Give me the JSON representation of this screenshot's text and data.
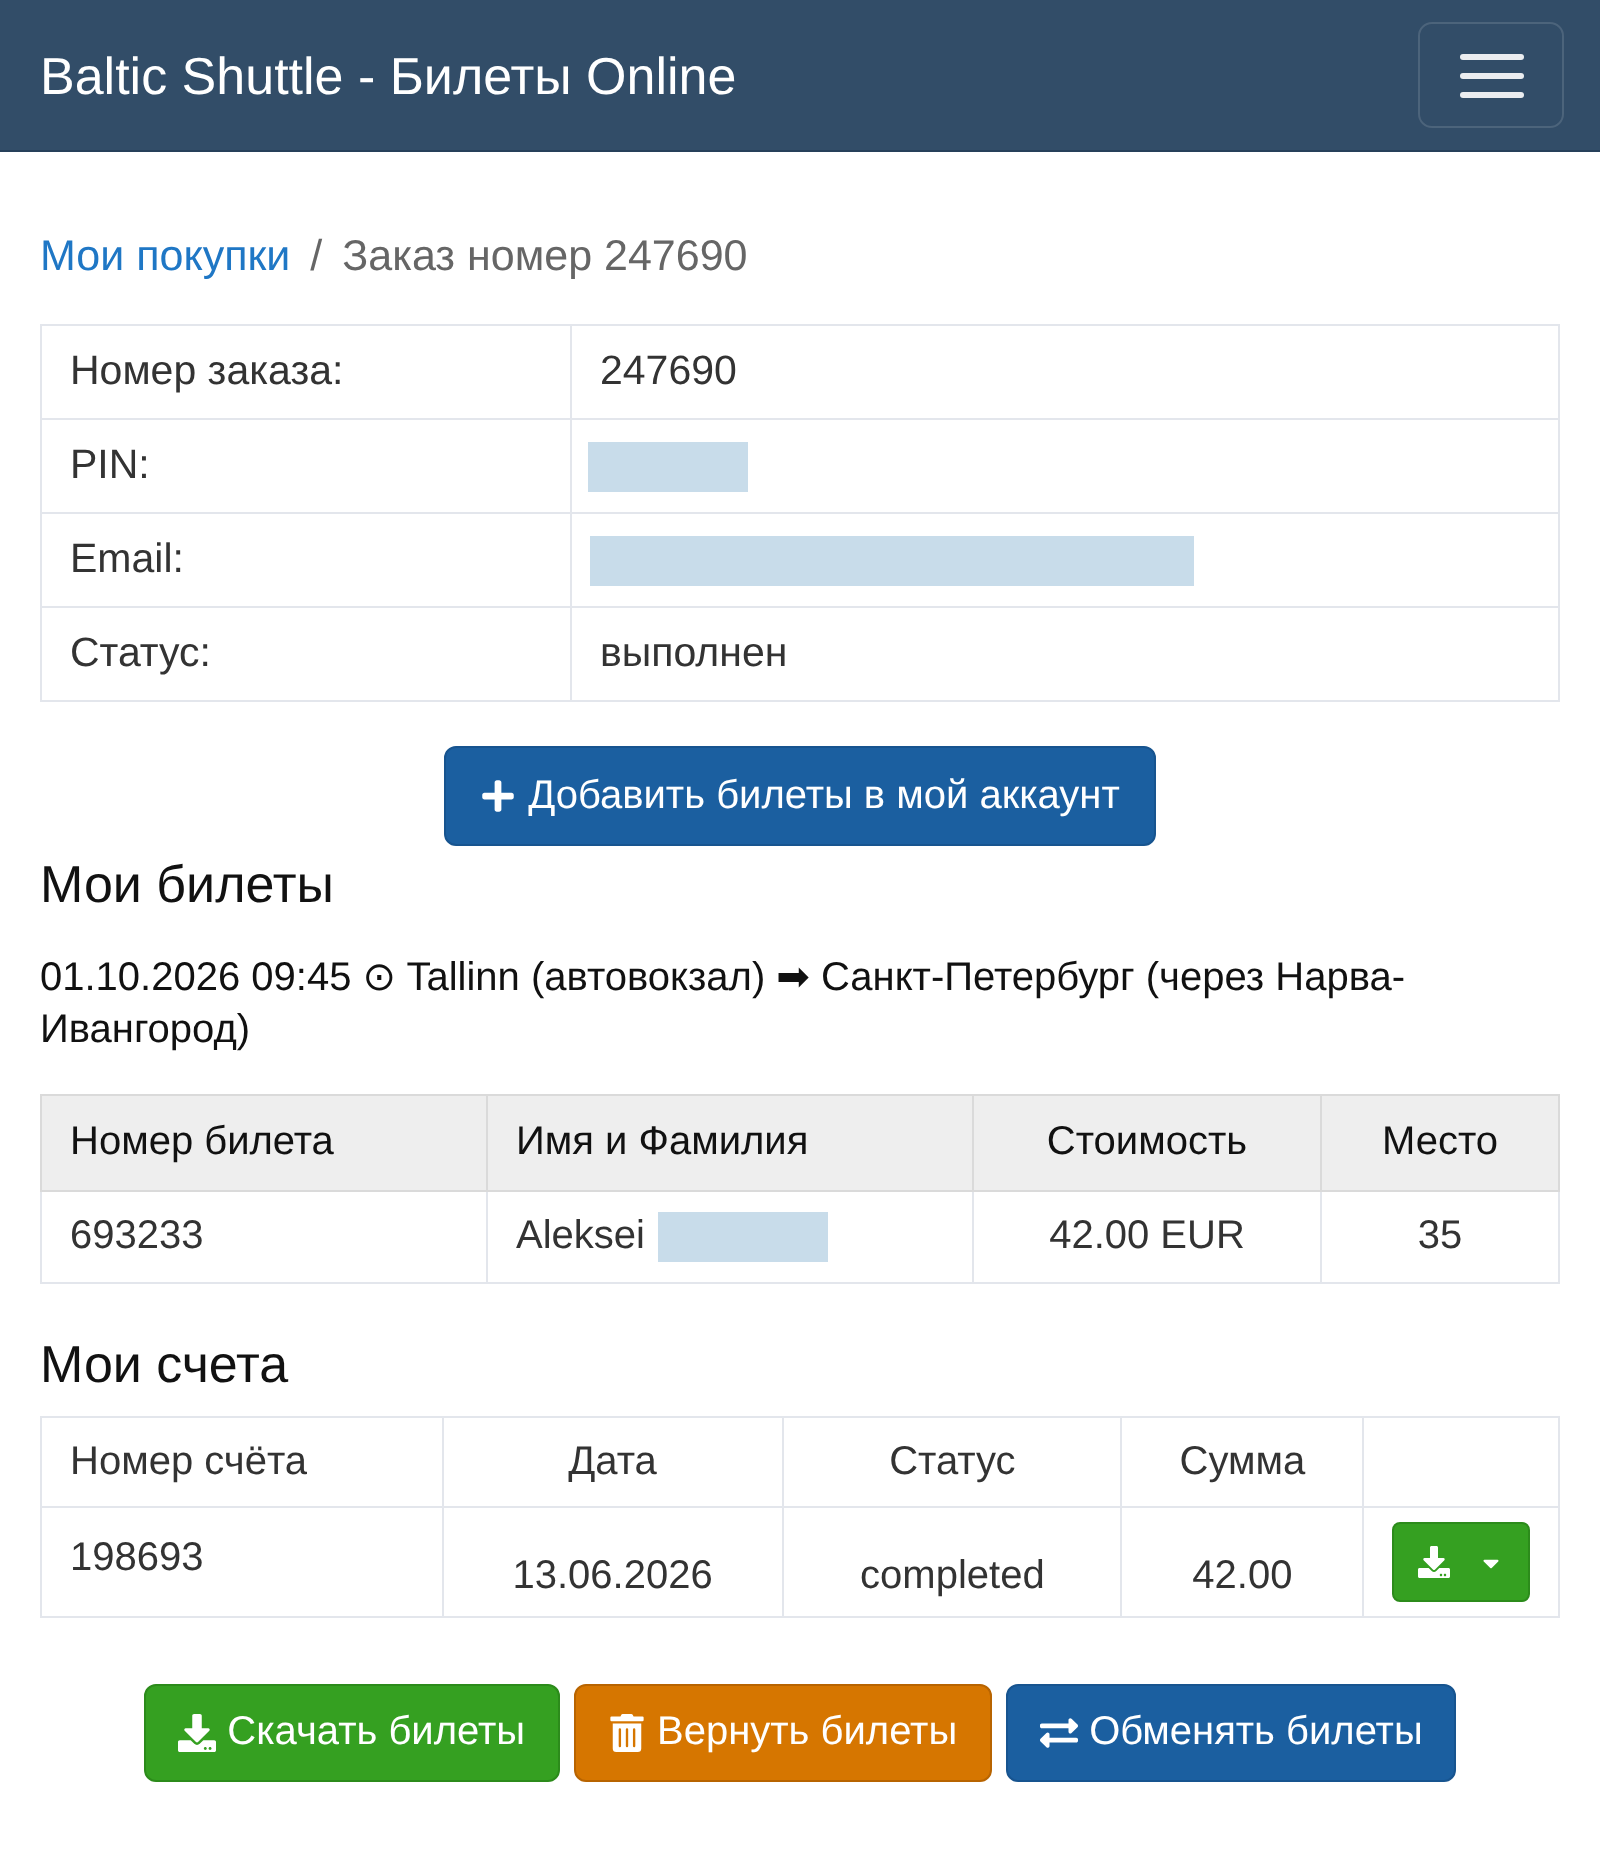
{
  "navbar": {
    "brand": "Baltic Shuttle - Билеты Online"
  },
  "breadcrumb": {
    "separator": "/",
    "items": [
      {
        "label": "Мои покупки",
        "kind": "link"
      },
      {
        "label": "Заказ номер 247690",
        "kind": "current"
      }
    ]
  },
  "order_info": [
    {
      "label": "Номер заказа:",
      "kind": "text",
      "value": "247690"
    },
    {
      "label": "PIN:",
      "kind": "pin"
    },
    {
      "label": "Email:",
      "kind": "email"
    },
    {
      "label": "Статус:",
      "kind": "text",
      "value": "выполнен"
    }
  ],
  "add_button": {
    "label": "Добавить билеты в мой аккаунт"
  },
  "tickets": {
    "title": "Мои билеты",
    "trip": "01.10.2026 09:45 ⊙ Tallinn (автовокзал) ➡ Санкт-Петербург (через Нарва-Ивангород)",
    "columns": [
      "Номер билета",
      "Имя и Фамилия",
      "Стоимость",
      "Место"
    ],
    "rows": [
      {
        "number": "693233",
        "first_name": "Aleksei",
        "last_name_redacted": true,
        "price": "42.00 EUR",
        "seat": "35"
      }
    ]
  },
  "invoices": {
    "title": "Мои счета",
    "columns": [
      "Номер счёта",
      "Дата",
      "Статус",
      "Сумма"
    ],
    "rows": [
      {
        "number": "198693",
        "date": "13.06.2026",
        "status": "completed",
        "amount": "42.00"
      }
    ]
  },
  "actions": [
    {
      "label": "Скачать билеты",
      "kind": "download"
    },
    {
      "label": "Вернуть билеты",
      "kind": "refund"
    },
    {
      "label": "Обменять билеты",
      "kind": "exchange"
    }
  ]
}
